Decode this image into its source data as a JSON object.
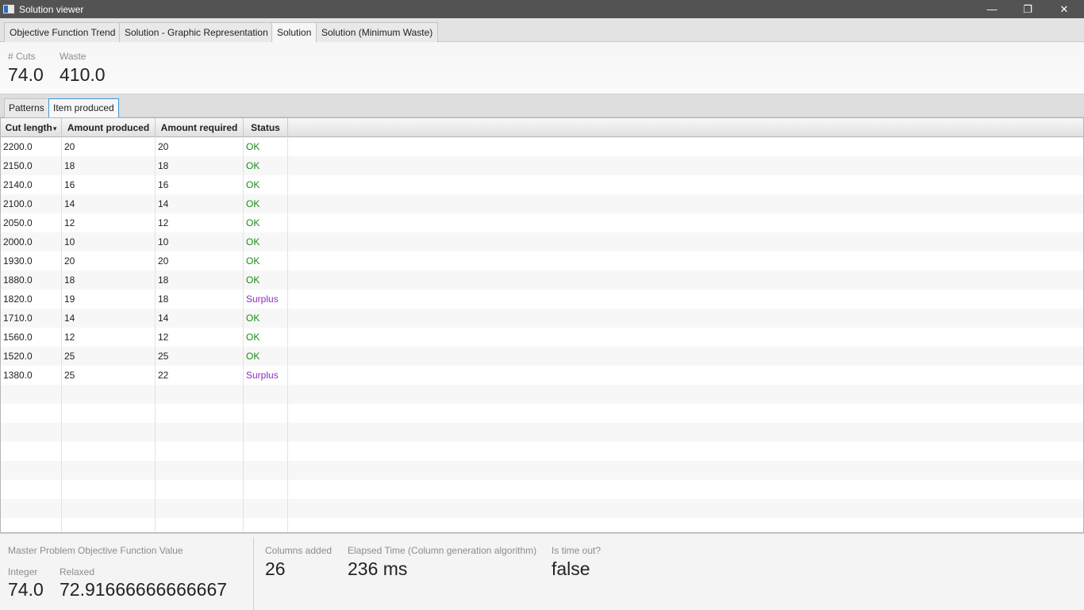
{
  "window": {
    "title": "Solution viewer",
    "min_glyph": "—",
    "max_glyph": "❐",
    "close_glyph": "✕"
  },
  "top_tabs": [
    {
      "label": "Objective Function Trend"
    },
    {
      "label": "Solution - Graphic Representation"
    },
    {
      "label": "Solution"
    },
    {
      "label": "Solution (Minimum Waste)"
    }
  ],
  "summary": {
    "cuts_label": "# Cuts",
    "cuts_value": "74.0",
    "waste_label": "Waste",
    "waste_value": "410.0"
  },
  "sub_tabs": [
    {
      "label": "Patterns"
    },
    {
      "label": "Item produced"
    }
  ],
  "table": {
    "columns": [
      "Cut length",
      "Amount produced",
      "Amount required",
      "Status"
    ],
    "sort_glyph": "▾",
    "rows": [
      [
        "2200.0",
        "20",
        "20",
        "OK"
      ],
      [
        "2150.0",
        "18",
        "18",
        "OK"
      ],
      [
        "2140.0",
        "16",
        "16",
        "OK"
      ],
      [
        "2100.0",
        "14",
        "14",
        "OK"
      ],
      [
        "2050.0",
        "12",
        "12",
        "OK"
      ],
      [
        "2000.0",
        "10",
        "10",
        "OK"
      ],
      [
        "1930.0",
        "20",
        "20",
        "OK"
      ],
      [
        "1880.0",
        "18",
        "18",
        "OK"
      ],
      [
        "1820.0",
        "19",
        "18",
        "Surplus"
      ],
      [
        "1710.0",
        "14",
        "14",
        "OK"
      ],
      [
        "1560.0",
        "12",
        "12",
        "OK"
      ],
      [
        "1520.0",
        "25",
        "25",
        "OK"
      ],
      [
        "1380.0",
        "25",
        "22",
        "Surplus"
      ]
    ],
    "status_colors": {
      "OK": "#1a8a1a",
      "Surplus": "#8a2fbf"
    }
  },
  "footer": {
    "master_label": "Master Problem Objective Function Value",
    "integer_label": "Integer",
    "integer_value": "74.0",
    "relaxed_label": "Relaxed",
    "relaxed_value": "72.91666666666667",
    "columns_label": "Columns added",
    "columns_value": "26",
    "elapsed_label": "Elapsed Time (Column generation algorithm)",
    "elapsed_value": "236 ms",
    "timeout_label": "Is time out?",
    "timeout_value": "false"
  }
}
